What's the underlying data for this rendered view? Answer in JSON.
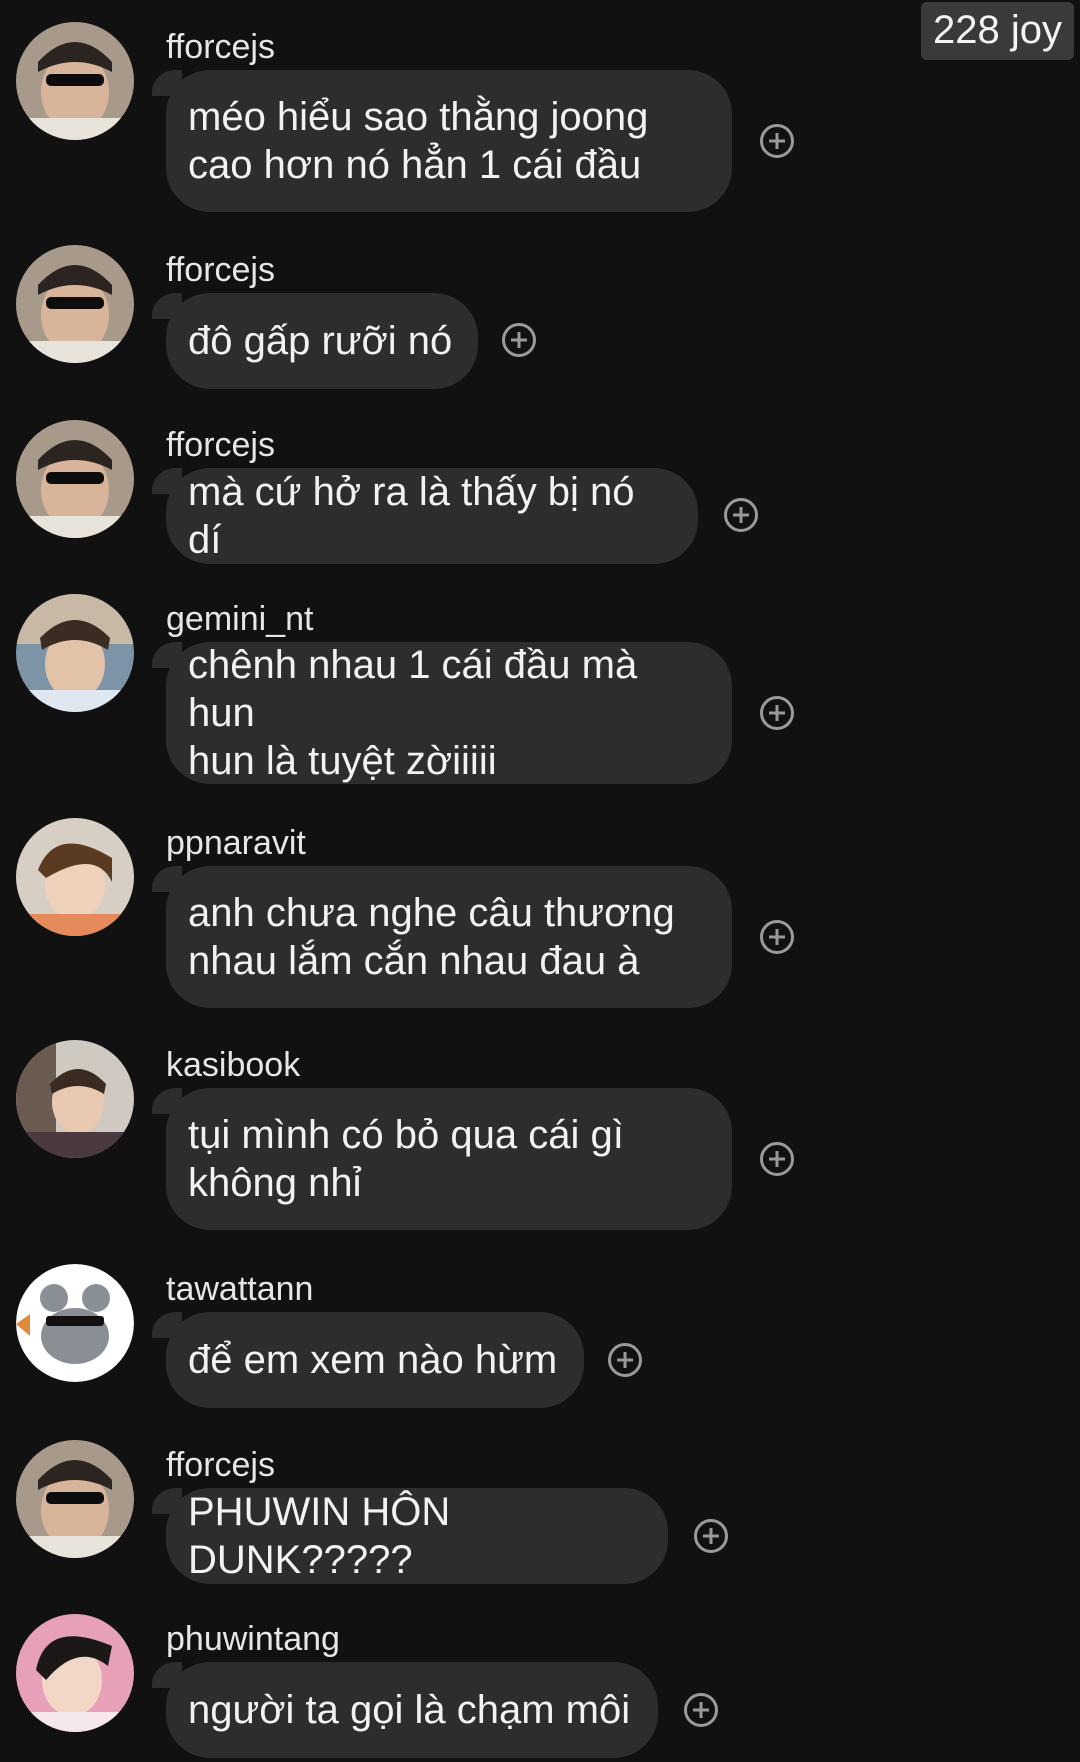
{
  "header": {
    "badge_text": "228 joy"
  },
  "messages": [
    {
      "username": "fforcejs",
      "text": "méo hiểu sao thằng joong\ncao hơn nó hẳn 1 cái đầu",
      "avatar": "fforcejs-avatar"
    },
    {
      "username": "fforcejs",
      "text": "đô gấp rưỡi nó",
      "avatar": "fforcejs-avatar"
    },
    {
      "username": "fforcejs",
      "text": "mà cứ hở ra là thấy bị nó dí",
      "avatar": "fforcejs-avatar"
    },
    {
      "username": "gemini_nt",
      "text": "chênh nhau 1 cái đầu mà hun\nhun là tuyệt zờiiiii",
      "avatar": "gemini_nt-avatar"
    },
    {
      "username": "ppnaravit",
      "text": "anh chưa nghe câu thương\nnhau lắm cắn nhau đau à",
      "avatar": "ppnaravit-avatar"
    },
    {
      "username": "kasibook",
      "text": "tụi mình có bỏ qua cái gì\nkhông nhỉ",
      "avatar": "kasibook-avatar"
    },
    {
      "username": "tawattann",
      "text": "để em xem nào hừm",
      "avatar": "tawattann-avatar"
    },
    {
      "username": "fforcejs",
      "text": "PHUWIN HÔN DUNK?????",
      "avatar": "fforcejs-avatar"
    },
    {
      "username": "phuwintang",
      "text": "người ta gọi là chạm môi",
      "avatar": "phuwintang-avatar"
    }
  ],
  "colors": {
    "background": "#111111",
    "bubble": "#2d2d2d",
    "badge": "#3a3a3a",
    "react_icon": "#9a9a9a"
  },
  "icons": {
    "react": "add-reaction-icon"
  }
}
